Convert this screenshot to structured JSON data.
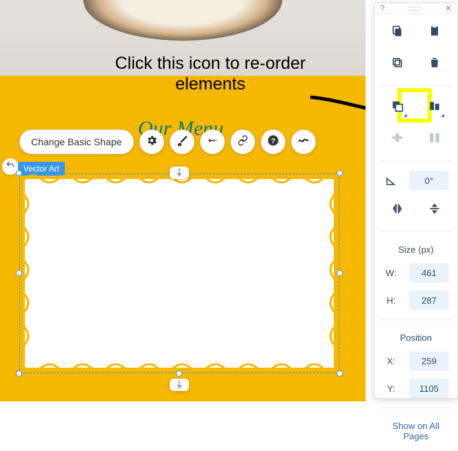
{
  "annotation": {
    "text": "Click this icon to re-order elements"
  },
  "canvas": {
    "decor_title": "Our Menu",
    "selected_element_label": "Vector Art",
    "toolbar": {
      "change_shape": "Change Basic Shape"
    }
  },
  "panel": {
    "help": "?",
    "close": "✕",
    "rotation": "0°",
    "size_title": "Size (px)",
    "w_label": "W:",
    "h_label": "H:",
    "w": "461",
    "h": "287",
    "position_title": "Position",
    "x_label": "X:",
    "y_label": "Y:",
    "x": "259",
    "y": "1105",
    "show_all": "Show on All Pages"
  }
}
